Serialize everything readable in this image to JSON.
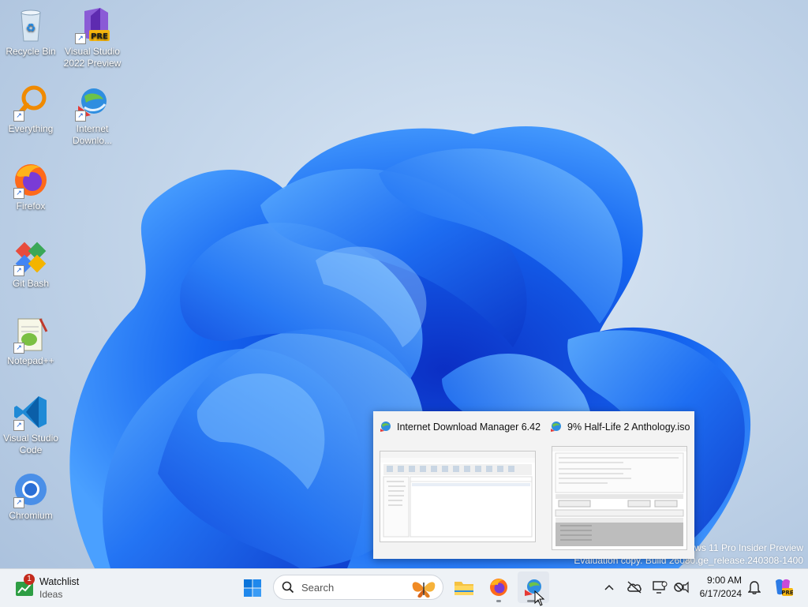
{
  "desktop": {
    "icons": [
      {
        "label": "Recycle Bin",
        "icon": "recycle-bin-icon"
      },
      {
        "label": "Visual Studio 2022 Preview",
        "icon": "visual-studio-preview-icon",
        "badge": "PRE"
      },
      {
        "label": "Everything",
        "icon": "everything-search-icon"
      },
      {
        "label": "Internet Downlo...",
        "icon": "internet-download-manager-icon"
      },
      {
        "label": "Firefox",
        "icon": "firefox-icon"
      },
      {
        "label": "Git Bash",
        "icon": "git-bash-icon"
      },
      {
        "label": "Notepad++",
        "icon": "notepad-plus-plus-icon"
      },
      {
        "label": "Visual Studio Code",
        "icon": "vscode-icon"
      },
      {
        "label": "Chromium",
        "icon": "chromium-icon"
      }
    ],
    "watermark": {
      "line1": "ows 11 Pro Insider Preview",
      "line2": "Evaluation copy. Build 26080.ge_release.240308-1400"
    }
  },
  "preview": {
    "windows": [
      {
        "title": "Internet Download Manager 6.42",
        "icon": "idm-icon"
      },
      {
        "title": "9% Half-Life 2 Anthology.iso",
        "icon": "idm-icon"
      }
    ]
  },
  "taskbar": {
    "widget": {
      "title": "Watchlist",
      "subtitle": "Ideas",
      "badge": "1"
    },
    "search": {
      "placeholder": "Search"
    },
    "apps": [
      "start-icon",
      "file-explorer-icon",
      "firefox-icon",
      "internet-download-manager-icon"
    ],
    "tray": {
      "time": "9:00 AM",
      "date": "6/17/2024"
    }
  },
  "colors": {
    "accent": "#0067c0",
    "bloom_dark": "#0a3fd0",
    "bloom_light": "#3d8bff",
    "taskbar": "#eef2f6"
  }
}
